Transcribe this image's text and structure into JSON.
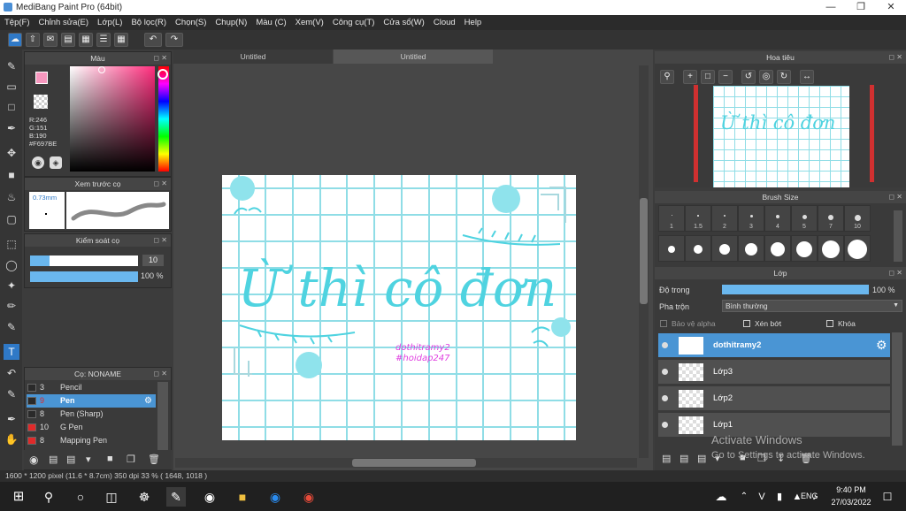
{
  "window": {
    "title": "MediBang Paint Pro (64bit)"
  },
  "menu": [
    "Tệp(F)",
    "Chỉnh sửa(E)",
    "Lớp(L)",
    "Bộ lọc(R)",
    "Chọn(S)",
    "Chụp(N)",
    "Màu (C)",
    "Xem(V)",
    "Công cụ(T)",
    "Cửa sổ(W)",
    "Cloud",
    "Help"
  ],
  "color_panel": {
    "title": "Màu",
    "r": "R:246",
    "g": "G:151",
    "b": "B:190",
    "hex": "#F697BE",
    "primary": "#f697be",
    "secondary": "#ffffff"
  },
  "brush_preview": {
    "title": "Xem trước cọ",
    "size": "0.73mm"
  },
  "brush_control": {
    "title": "Kiểm soát cọ",
    "size_value": "10",
    "opacity_value": "100 %"
  },
  "brush_list": {
    "title": "Cọ: NONAME",
    "items": [
      {
        "num": "3",
        "name": "Pencil",
        "color": "#2a2a2a"
      },
      {
        "num": "9",
        "name": "Pen",
        "color": "#2a2a2a"
      },
      {
        "num": "8",
        "name": "Pen (Sharp)",
        "color": "#2a2a2a"
      },
      {
        "num": "10",
        "name": "G Pen",
        "color": "#e02a2a"
      },
      {
        "num": "8",
        "name": "Mapping Pen",
        "color": "#e02a2a"
      }
    ]
  },
  "tabs": [
    "Untitled",
    "Untitled"
  ],
  "artwork": {
    "text": "Ừ thì cô đơn",
    "credit1": "dothitramy2",
    "credit2": "#hoidap247"
  },
  "navigator": {
    "title": "Hoa tiêu"
  },
  "brush_size": {
    "title": "Brush Size",
    "sizes": [
      "1",
      "1.5",
      "2",
      "3",
      "4",
      "5",
      "7",
      "10"
    ]
  },
  "layers": {
    "title": "Lớp",
    "opacity_label": "Độ trong",
    "opacity_value": "100 %",
    "blend_label": "Pha trộn",
    "blend_value": "Bình thường",
    "protect_alpha": "Bảo vệ alpha",
    "clipping": "Xén bớt",
    "lock": "Khóa",
    "items": [
      "dothitramy2",
      "Lớp3",
      "Lớp2",
      "Lớp1"
    ]
  },
  "watermark": {
    "line1": "Activate Windows",
    "line2": "Go to Settings to activate Windows."
  },
  "status": "1600 * 1200 pixel   (11.6 * 8.7cm)  350 dpi  33 %  ( 1648, 1018 )",
  "taskbar": {
    "time": "9:40 PM",
    "date": "27/03/2022",
    "lang": "ENG"
  }
}
